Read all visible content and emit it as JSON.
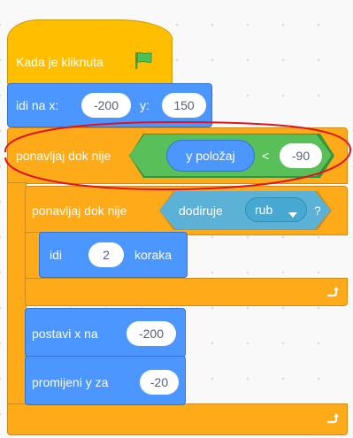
{
  "script": {
    "hat": {
      "label": "Kada je kliknuta",
      "icon": "green-flag-icon"
    },
    "goto": {
      "label_x": "idi na x:",
      "x_value": "-200",
      "label_y": "y:",
      "y_value": "150"
    },
    "outer_repeat": {
      "label": "ponavljaj dok nije",
      "condition": {
        "reporter": "y položaj",
        "operator": "<",
        "value": "-90"
      }
    },
    "inner_repeat": {
      "label": "ponavljaj dok nije",
      "condition": {
        "label": "dodiruje",
        "option": "rub",
        "question": "?"
      }
    },
    "move": {
      "label": "idi",
      "steps": "2",
      "unit": "koraka"
    },
    "set_x": {
      "label": "postavi x na",
      "value": "-200"
    },
    "change_y": {
      "label": "promijeni y za",
      "value": "-20"
    },
    "loop_arrow_icon": "loop-arrow-icon"
  },
  "annotation": {
    "color": "#e0141e",
    "shape": "ellipse"
  },
  "colors": {
    "events": "#ffbf00",
    "motion": "#4c97ff",
    "control": "#ffab19",
    "operators": "#59c059",
    "sensing": "#5cb1d6",
    "workspace": "#f9f9f9"
  }
}
